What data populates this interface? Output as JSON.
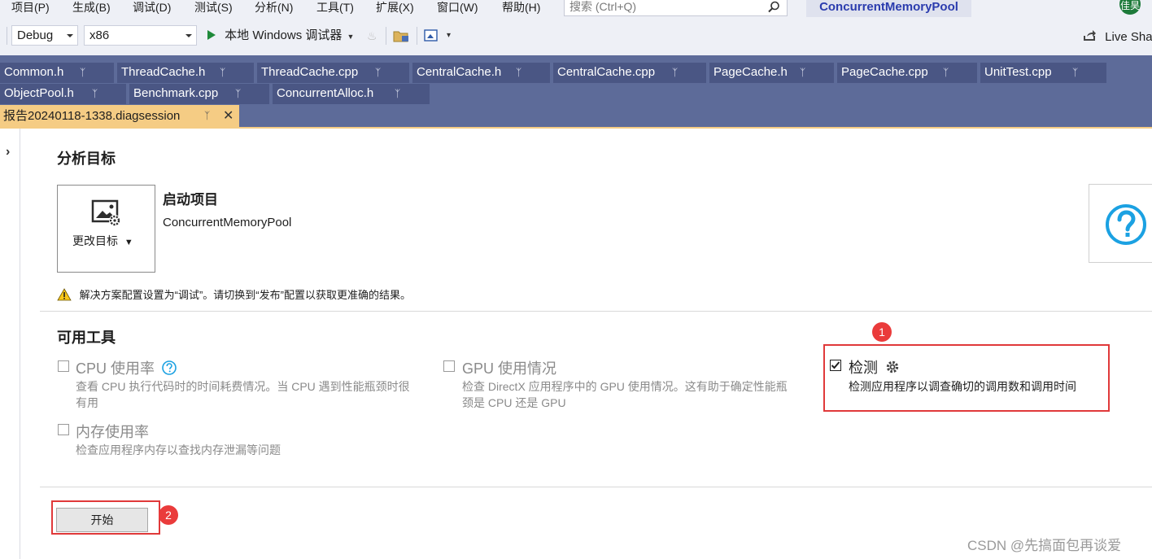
{
  "menu": {
    "items": [
      "项目(P)",
      "生成(B)",
      "调试(D)",
      "测试(S)",
      "分析(N)",
      "工具(T)",
      "扩展(X)",
      "窗口(W)",
      "帮助(H)"
    ],
    "search_placeholder": "搜索 (Ctrl+Q)",
    "project_title": "ConcurrentMemoryPool",
    "avatar_text": "佳昊"
  },
  "toolbar": {
    "config": "Debug",
    "platform": "x86",
    "run_label": "本地 Windows 调试器",
    "live_share": "Live Sha"
  },
  "tabs": {
    "row1": [
      "Common.h",
      "ThreadCache.h",
      "ThreadCache.cpp",
      "CentralCache.h",
      "CentralCache.cpp",
      "PageCache.h",
      "PageCache.cpp",
      "UnitTest.cpp"
    ],
    "row2": [
      "ObjectPool.h",
      "Benchmark.cpp",
      "ConcurrentAlloc.h"
    ],
    "active": "报告20240118-1338.diagsession"
  },
  "target": {
    "heading": "分析目标",
    "change_target": "更改目标",
    "startup_title": "启动项目",
    "startup_name": "ConcurrentMemoryPool",
    "warning": "解决方案配置设置为“调试”。请切换到“发布”配置以获取更准确的结果。"
  },
  "tools": {
    "heading": "可用工具",
    "cpu": {
      "title": "CPU 使用率",
      "desc1": "查看 CPU 执行代码时的时间耗费情况。当 CPU 遇到性能瓶颈时很",
      "desc2": "有用",
      "checked": false
    },
    "gpu": {
      "title": "GPU 使用情况",
      "desc1": "检查 DirectX 应用程序中的 GPU 使用情况。这有助于确定性能瓶",
      "desc2": "颈是 CPU 还是 GPU",
      "checked": false
    },
    "instrument": {
      "title": "检测",
      "desc": "检测应用程序以调查确切的调用数和调用时间",
      "checked": true
    },
    "memory": {
      "title": "内存使用率",
      "desc": "检查应用程序内存以查找内存泄漏等问题",
      "checked": false
    }
  },
  "start_button": "开始",
  "badges": [
    "1",
    "2"
  ],
  "watermark": "CSDN @先搞面包再谈爱",
  "colors": {
    "accent_tab": "#f5cc84",
    "tab_well": "#5d6b99",
    "highlight": "#e0393a",
    "help": "#1ba1e2"
  }
}
